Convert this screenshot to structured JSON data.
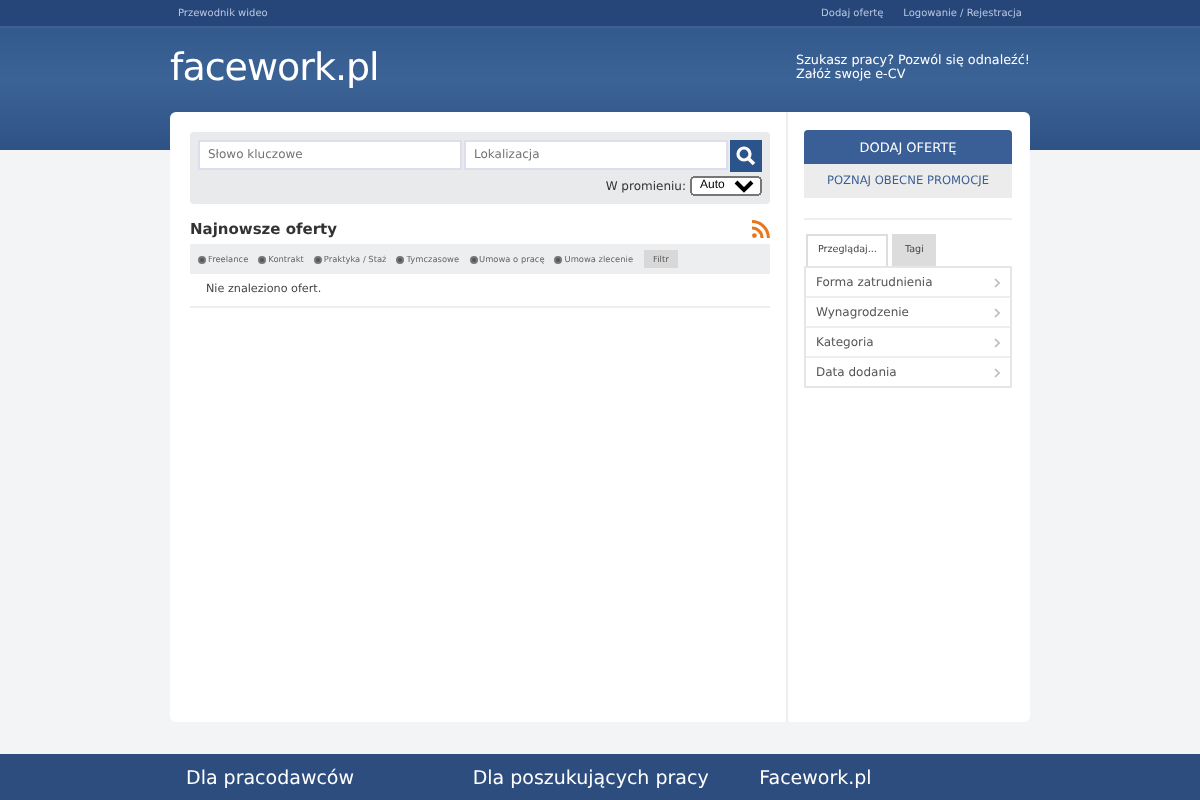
{
  "top_bar": {
    "left_link": "Przewodnik wideo",
    "right_links": [
      "Dodaj ofertę",
      "Logowanie / Rejestracja"
    ]
  },
  "header": {
    "logo": "facework.pl",
    "tagline_1": "Szukasz pracy? Pozwól się odnaleźć!",
    "tagline_2": "Załóż swoje e-CV"
  },
  "search": {
    "keyword_placeholder": "Słowo kluczowe",
    "location_placeholder": "Lokalizacja",
    "radius_label": "W promieniu:",
    "radius_value": "Auto"
  },
  "offers": {
    "title": "Najnowsze oferty",
    "filters": [
      {
        "label": "Freelance",
        "checked": true
      },
      {
        "label": "Kontrakt",
        "checked": true
      },
      {
        "label": "Praktyka / Staż",
        "checked": true
      },
      {
        "label": "Tymczasowe",
        "checked": true
      },
      {
        "label": "Umowa o pracę",
        "checked": true
      },
      {
        "label": "Umowa zlecenie",
        "checked": true
      }
    ],
    "filter_button": "Filtr",
    "empty_message": "Nie znaleziono ofert."
  },
  "sidebar": {
    "add_button": "DODAJ OFERTĘ",
    "promo_button": "POZNAJ OBECNE PROMOCJE",
    "tabs": [
      {
        "label": "Przeglądaj...",
        "selected": true
      },
      {
        "label": "Tagi",
        "selected": false
      }
    ],
    "items": [
      "Forma zatrudnienia",
      "Wynagrodzenie",
      "Kategoria",
      "Data dodania"
    ]
  },
  "footer": {
    "columns": [
      "Dla pracodawców",
      "Dla poszukujących pracy",
      "Facework.pl"
    ]
  }
}
